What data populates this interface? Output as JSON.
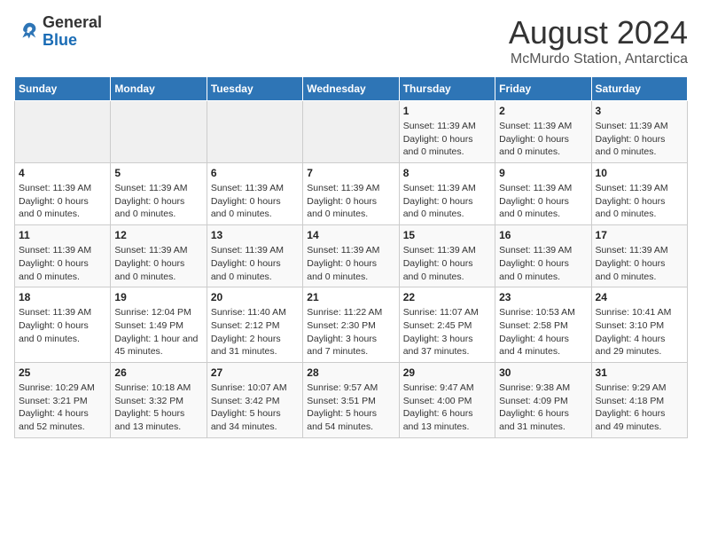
{
  "header": {
    "logo_general": "General",
    "logo_blue": "Blue",
    "title": "August 2024",
    "subtitle": "McMurdo Station, Antarctica"
  },
  "calendar": {
    "days_of_week": [
      "Sunday",
      "Monday",
      "Tuesday",
      "Wednesday",
      "Thursday",
      "Friday",
      "Saturday"
    ],
    "weeks": [
      [
        {
          "day": "",
          "info": ""
        },
        {
          "day": "",
          "info": ""
        },
        {
          "day": "",
          "info": ""
        },
        {
          "day": "",
          "info": ""
        },
        {
          "day": "1",
          "info": "Sunset: 11:39 AM\nDaylight: 0 hours\nand 0 minutes."
        },
        {
          "day": "2",
          "info": "Sunset: 11:39 AM\nDaylight: 0 hours\nand 0 minutes."
        },
        {
          "day": "3",
          "info": "Sunset: 11:39 AM\nDaylight: 0 hours\nand 0 minutes."
        }
      ],
      [
        {
          "day": "4",
          "info": "Sunset: 11:39 AM\nDaylight: 0 hours\nand 0 minutes."
        },
        {
          "day": "5",
          "info": "Sunset: 11:39 AM\nDaylight: 0 hours\nand 0 minutes."
        },
        {
          "day": "6",
          "info": "Sunset: 11:39 AM\nDaylight: 0 hours\nand 0 minutes."
        },
        {
          "day": "7",
          "info": "Sunset: 11:39 AM\nDaylight: 0 hours\nand 0 minutes."
        },
        {
          "day": "8",
          "info": "Sunset: 11:39 AM\nDaylight: 0 hours\nand 0 minutes."
        },
        {
          "day": "9",
          "info": "Sunset: 11:39 AM\nDaylight: 0 hours\nand 0 minutes."
        },
        {
          "day": "10",
          "info": "Sunset: 11:39 AM\nDaylight: 0 hours\nand 0 minutes."
        }
      ],
      [
        {
          "day": "11",
          "info": "Sunset: 11:39 AM\nDaylight: 0 hours\nand 0 minutes."
        },
        {
          "day": "12",
          "info": "Sunset: 11:39 AM\nDaylight: 0 hours\nand 0 minutes."
        },
        {
          "day": "13",
          "info": "Sunset: 11:39 AM\nDaylight: 0 hours\nand 0 minutes."
        },
        {
          "day": "14",
          "info": "Sunset: 11:39 AM\nDaylight: 0 hours\nand 0 minutes."
        },
        {
          "day": "15",
          "info": "Sunset: 11:39 AM\nDaylight: 0 hours\nand 0 minutes."
        },
        {
          "day": "16",
          "info": "Sunset: 11:39 AM\nDaylight: 0 hours\nand 0 minutes."
        },
        {
          "day": "17",
          "info": "Sunset: 11:39 AM\nDaylight: 0 hours\nand 0 minutes."
        }
      ],
      [
        {
          "day": "18",
          "info": "Sunset: 11:39 AM\nDaylight: 0 hours\nand 0 minutes."
        },
        {
          "day": "19",
          "info": "Sunrise: 12:04 PM\nSunset: 1:49 PM\nDaylight: 1 hour and\n45 minutes."
        },
        {
          "day": "20",
          "info": "Sunrise: 11:40 AM\nSunset: 2:12 PM\nDaylight: 2 hours\nand 31 minutes."
        },
        {
          "day": "21",
          "info": "Sunrise: 11:22 AM\nSunset: 2:30 PM\nDaylight: 3 hours\nand 7 minutes."
        },
        {
          "day": "22",
          "info": "Sunrise: 11:07 AM\nSunset: 2:45 PM\nDaylight: 3 hours\nand 37 minutes."
        },
        {
          "day": "23",
          "info": "Sunrise: 10:53 AM\nSunset: 2:58 PM\nDaylight: 4 hours\nand 4 minutes."
        },
        {
          "day": "24",
          "info": "Sunrise: 10:41 AM\nSunset: 3:10 PM\nDaylight: 4 hours\nand 29 minutes."
        }
      ],
      [
        {
          "day": "25",
          "info": "Sunrise: 10:29 AM\nSunset: 3:21 PM\nDaylight: 4 hours\nand 52 minutes."
        },
        {
          "day": "26",
          "info": "Sunrise: 10:18 AM\nSunset: 3:32 PM\nDaylight: 5 hours\nand 13 minutes."
        },
        {
          "day": "27",
          "info": "Sunrise: 10:07 AM\nSunset: 3:42 PM\nDaylight: 5 hours\nand 34 minutes."
        },
        {
          "day": "28",
          "info": "Sunrise: 9:57 AM\nSunset: 3:51 PM\nDaylight: 5 hours\nand 54 minutes."
        },
        {
          "day": "29",
          "info": "Sunrise: 9:47 AM\nSunset: 4:00 PM\nDaylight: 6 hours\nand 13 minutes."
        },
        {
          "day": "30",
          "info": "Sunrise: 9:38 AM\nSunset: 4:09 PM\nDaylight: 6 hours\nand 31 minutes."
        },
        {
          "day": "31",
          "info": "Sunrise: 9:29 AM\nSunset: 4:18 PM\nDaylight: 6 hours\nand 49 minutes."
        }
      ]
    ]
  }
}
